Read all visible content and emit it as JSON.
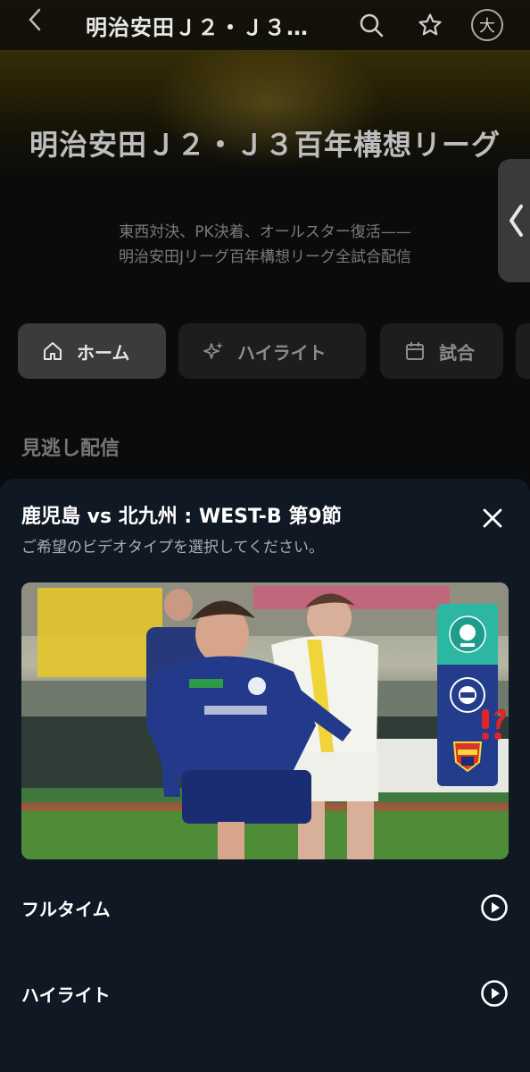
{
  "header": {
    "title": "明治安田Ｊ２・Ｊ３…",
    "font_size_button": "大"
  },
  "league": {
    "title": "明治安田Ｊ２・Ｊ３百年構想リーグ",
    "description_line1": "東西対決、PK決着、オールスター復活——",
    "description_line2": "明治安田Jリーグ百年構想リーグ全試合配信"
  },
  "tabs": [
    {
      "label": "ホーム",
      "icon": "home-icon",
      "active": true
    },
    {
      "label": "ハイライト",
      "icon": "sparkle-icon",
      "active": false
    },
    {
      "label": "試合",
      "icon": "calendar-icon",
      "active": false
    }
  ],
  "section": {
    "title": "見逃し配信"
  },
  "sheet": {
    "title": "鹿児島 vs 北九州 : WEST-B 第9節",
    "subtitle": "ご希望のビデオタイプを選択してください。",
    "options": [
      {
        "label": "フルタイム",
        "icon": "play-icon"
      },
      {
        "label": "ハイライト",
        "icon": "play-icon"
      }
    ]
  },
  "colors": {
    "sheet_bg": "#101823",
    "accent": "#ffffff",
    "home_team": "#233a8a",
    "away_team": "#f4d93a"
  }
}
